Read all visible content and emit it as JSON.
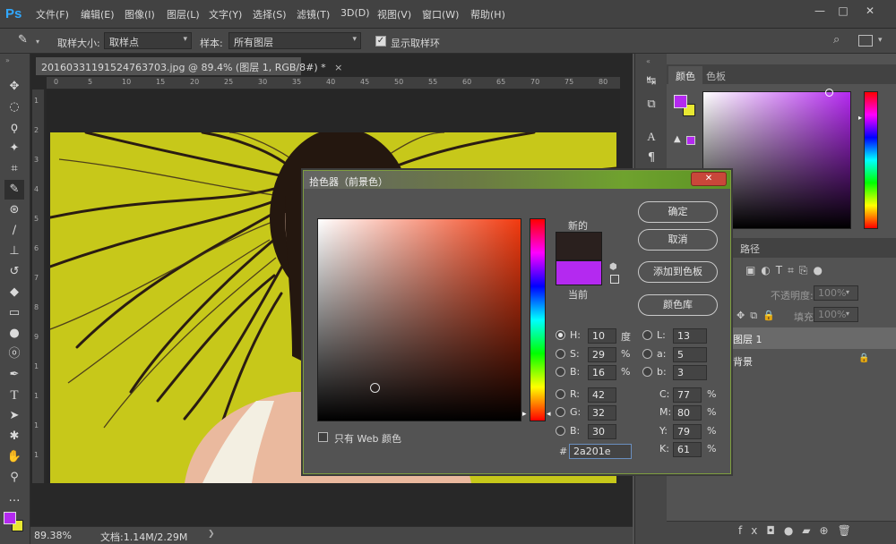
{
  "app": {
    "logo": "Ps"
  },
  "menu": [
    "文件(F)",
    "编辑(E)",
    "图像(I)",
    "图层(L)",
    "文字(Y)",
    "选择(S)",
    "滤镜(T)",
    "3D(D)",
    "视图(V)",
    "窗口(W)",
    "帮助(H)"
  ],
  "options": {
    "sample_size_label": "取样大小:",
    "sample_size_value": "取样点",
    "sample_label": "样本:",
    "sample_value": "所有图层",
    "show_ring_label": "显示取样环",
    "show_ring_checked": true
  },
  "document": {
    "tab_title": "20160331191524763703.jpg @ 89.4% (图层 1, RGB/8#) *",
    "close_glyph": "×",
    "ruler_h": [
      "0",
      "5",
      "10",
      "15",
      "20",
      "25",
      "30",
      "35",
      "40",
      "45",
      "50",
      "55",
      "60",
      "65",
      "70",
      "75",
      "80"
    ],
    "ruler_v": [
      "1",
      "2",
      "3",
      "4",
      "5",
      "6",
      "7",
      "8",
      "9",
      "1",
      "1",
      "1",
      "1"
    ]
  },
  "status": {
    "zoom": "89.38%",
    "doc": "文档:1.14M/2.29M",
    "arrow": "❯"
  },
  "panels": {
    "color_tab": "颜色",
    "swatches_tab": "色板",
    "paths_tab": "路径",
    "opacity_label": "不透明度:",
    "opacity_value": "100%",
    "fill_label": "填充:",
    "fill_value": "100%",
    "layers": [
      {
        "name": "图层 1",
        "selected": true
      },
      {
        "name": "背景",
        "locked": true
      }
    ],
    "foreground_color": "#b429f0",
    "background_color": "#e8e832"
  },
  "dialog": {
    "title": "拾色器（前景色）",
    "close_glyph": "✕",
    "new_label": "新的",
    "current_label": "当前",
    "new_color": "#2a201e",
    "current_color": "#b429f0",
    "buttons": {
      "ok": "确定",
      "cancel": "取消",
      "add_swatch": "添加到色板",
      "libraries": "颜色库"
    },
    "web_only_label": "只有 Web 颜色",
    "hsb": {
      "H": "10",
      "S": "29",
      "B": "16",
      "H_unit": "度",
      "S_unit": "%",
      "B_unit": "%"
    },
    "rgb": {
      "R": "42",
      "G": "32",
      "B": "30"
    },
    "lab": {
      "L": "13",
      "a": "5",
      "b": "3"
    },
    "cmyk": {
      "C": "77",
      "M": "80",
      "Y": "79",
      "K": "61",
      "unit": "%"
    },
    "hex_label": "#",
    "hex": "2a201e",
    "labels": {
      "H": "H:",
      "S": "S:",
      "B": "B:",
      "R": "R:",
      "G": "G:",
      "B2": "B:",
      "L": "L:",
      "a": "a:",
      "b": "b:",
      "C": "C:",
      "M": "M:",
      "Y": "Y:",
      "K": "K:"
    }
  }
}
